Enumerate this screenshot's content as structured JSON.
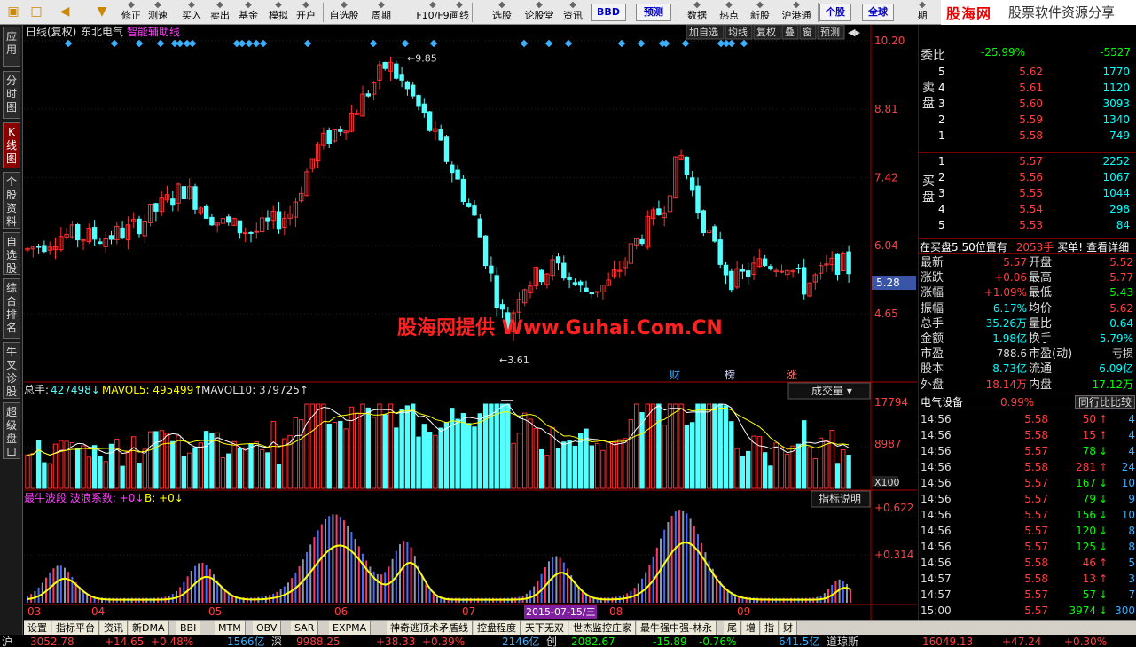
{
  "toolbar": {
    "items": [
      {
        "label": "修正"
      },
      {
        "label": "测速"
      },
      {
        "label": "买入"
      },
      {
        "label": "卖出"
      },
      {
        "label": "基金"
      },
      {
        "label": "模拟"
      },
      {
        "label": "开户"
      },
      {
        "label": "自选股"
      },
      {
        "label": "周期"
      },
      {
        "label": "F10/F9"
      },
      {
        "label": "画线"
      },
      {
        "label": "选股"
      },
      {
        "label": "论股堂"
      },
      {
        "label": "资讯"
      },
      {
        "label": "BBD"
      },
      {
        "label": "预测"
      },
      {
        "label": "数据"
      },
      {
        "label": "热点"
      },
      {
        "label": "新股"
      },
      {
        "label": "沪港通"
      },
      {
        "label": "个股"
      },
      {
        "label": "全球"
      },
      {
        "label": "期"
      }
    ],
    "brand_name": "股海网",
    "brand_sub": "股票软件资源分享",
    "brand_url": "www.Guhai.com.cn"
  },
  "left_tabs": [
    {
      "label": "应用"
    },
    {
      "label": "分时图"
    },
    {
      "label": "K线图"
    },
    {
      "label": "个股资料"
    },
    {
      "label": "自选股"
    },
    {
      "label": "综合排名"
    },
    {
      "label": "牛叉诊股"
    },
    {
      "label": "超级盘口"
    }
  ],
  "chart_header": {
    "period": "日线(复权)",
    "stock_name": "东北电气",
    "indicator": "智能辅助线",
    "buttons": [
      "加自选",
      "均线",
      "复权",
      "叠",
      "窗",
      "预测"
    ]
  },
  "price_axis": [
    "10.20",
    "8.81",
    "7.42",
    "6.04",
    "4.65"
  ],
  "current_price_marker": "5.28",
  "annotations": {
    "high": "9.85",
    "low": "3.61",
    "flags": [
      "财",
      "榜",
      "涨"
    ]
  },
  "volume_panel": {
    "total_label": "总手:",
    "total": "427498",
    "mavol5_label": "MAVOL5:",
    "mavol5": "495499",
    "mavol10_label": "MAVOL10:",
    "mavol10": "379725",
    "selector": "成交量",
    "axis": [
      "17794",
      "8987"
    ],
    "unit": "X100"
  },
  "indicator_panel": {
    "title": "最牛波段",
    "coef_label": "波浪系数:",
    "coef": "+0",
    "b_label": "B:",
    "b": "+0",
    "help": "指标说明",
    "axis": [
      "+0.622",
      "+0.314"
    ]
  },
  "date_axis": [
    "03",
    "04",
    "05",
    "06",
    "07",
    "08",
    "09"
  ],
  "date_cursor": "2015-07-15/三",
  "watermark": "股海网提供 Www.Guhai.Com.CN",
  "order_book": {
    "top_label": "委比",
    "top_value": "-25.99%",
    "top_diff": "-5527",
    "sell_label": "卖盘",
    "buy_label": "买盘",
    "sell": [
      {
        "level": "5",
        "price": "5.62",
        "vol": "1770"
      },
      {
        "level": "4",
        "price": "5.61",
        "vol": "1120"
      },
      {
        "level": "3",
        "price": "5.60",
        "vol": "3093"
      },
      {
        "level": "2",
        "price": "5.59",
        "vol": "1340"
      },
      {
        "level": "1",
        "price": "5.58",
        "vol": "749"
      }
    ],
    "buy": [
      {
        "level": "1",
        "price": "5.57",
        "vol": "2252"
      },
      {
        "level": "2",
        "price": "5.56",
        "vol": "1067"
      },
      {
        "level": "3",
        "price": "5.55",
        "vol": "1044"
      },
      {
        "level": "4",
        "price": "5.54",
        "vol": "298"
      },
      {
        "level": "5",
        "price": "5.53",
        "vol": "84"
      }
    ],
    "notice": "在买盘5.50位置有",
    "notice_vol": "2053手",
    "notice_action": "买单!",
    "notice_link": "查看详细"
  },
  "quote_stats": [
    {
      "l1": "最新",
      "v1": "5.57",
      "c1": "#ff4040",
      "l2": "开盘",
      "v2": "5.52",
      "c2": "#ff4040"
    },
    {
      "l1": "涨跌",
      "v1": "+0.06",
      "c1": "#ff4040",
      "l2": "最高",
      "v2": "5.77",
      "c2": "#ff4040"
    },
    {
      "l1": "涨幅",
      "v1": "+1.09%",
      "c1": "#ff4040",
      "l2": "最低",
      "v2": "5.43",
      "c2": "#00ff00"
    },
    {
      "l1": "振幅",
      "v1": "6.17%",
      "c1": "#00ffff",
      "l2": "均价",
      "v2": "5.62",
      "c2": "#ff4040"
    },
    {
      "l1": "总手",
      "v1": "35.26万",
      "c1": "#00ffff",
      "l2": "量比",
      "v2": "0.64",
      "c2": "#00ffff"
    },
    {
      "l1": "金额",
      "v1": "1.98亿",
      "c1": "#00ffff",
      "l2": "换手",
      "v2": "5.79%",
      "c2": "#00ffff"
    },
    {
      "l1": "市盈",
      "v1": "788.6",
      "c1": "#dddddd",
      "l2": "市盈(动)",
      "v2": "亏损",
      "c2": "#dddddd"
    },
    {
      "l1": "股本",
      "v1": "8.73亿",
      "c1": "#00ffff",
      "l2": "流通",
      "v2": "6.09亿",
      "c2": "#00ffff"
    },
    {
      "l1": "外盘",
      "v1": "18.14万",
      "c1": "#ff4040",
      "l2": "内盘",
      "v2": "17.12万",
      "c2": "#00ff00"
    }
  ],
  "sector": {
    "name": "电气设备",
    "change": "0.99%",
    "compare": "同行比比较"
  },
  "ticks": [
    {
      "time": "14:56",
      "price": "5.58",
      "vol": "50",
      "dir": "up",
      "num": "4"
    },
    {
      "time": "14:56",
      "price": "5.58",
      "vol": "15",
      "dir": "up",
      "num": "4"
    },
    {
      "time": "14:56",
      "price": "5.57",
      "vol": "78",
      "dir": "down",
      "num": "4"
    },
    {
      "time": "14:56",
      "price": "5.58",
      "vol": "281",
      "dir": "up",
      "num": "24"
    },
    {
      "time": "14:56",
      "price": "5.57",
      "vol": "167",
      "dir": "down",
      "num": "10"
    },
    {
      "time": "14:56",
      "price": "5.57",
      "vol": "79",
      "dir": "down",
      "num": "9"
    },
    {
      "time": "14:56",
      "price": "5.57",
      "vol": "156",
      "dir": "down",
      "num": "10"
    },
    {
      "time": "14:56",
      "price": "5.57",
      "vol": "120",
      "dir": "down",
      "num": "8"
    },
    {
      "time": "14:56",
      "price": "5.57",
      "vol": "125",
      "dir": "down",
      "num": "8"
    },
    {
      "time": "14:56",
      "price": "5.58",
      "vol": "46",
      "dir": "up",
      "num": "5"
    },
    {
      "time": "14:57",
      "price": "5.58",
      "vol": "13",
      "dir": "up",
      "num": "3"
    },
    {
      "time": "14:57",
      "price": "5.57",
      "vol": "57",
      "dir": "down",
      "num": "7"
    },
    {
      "time": "15:00",
      "price": "5.57",
      "vol": "3974",
      "dir": "down",
      "num": "300"
    }
  ],
  "bottom_tabs": [
    {
      "label": "设置"
    },
    {
      "label": "指标平台"
    },
    {
      "label": "资讯"
    },
    {
      "label": "新DMA"
    },
    {
      "label": "BBI"
    },
    {
      "label": "MTM"
    },
    {
      "label": "OBV"
    },
    {
      "label": "SAR"
    },
    {
      "label": "EXPMA"
    },
    {
      "label": "神奇逃顶术矛盾线"
    },
    {
      "label": "控盘程度"
    },
    {
      "label": "天下无双"
    },
    {
      "label": "世杰监控庄家"
    },
    {
      "label": "最牛强中强-林永"
    },
    {
      "label": "尾"
    },
    {
      "label": "增"
    },
    {
      "label": "指"
    },
    {
      "label": "财"
    }
  ],
  "status": {
    "sh": "沪",
    "sh_idx": "3052.78",
    "sh_chg": "+14.65",
    "sh_pct": "+0.48%",
    "sh_amt": "1566亿",
    "sz": "深",
    "sz_idx": "9988.25",
    "sz_chg": "+38.33",
    "sz_pct": "+0.39%",
    "sz_amt": "2146亿",
    "cy": "创",
    "cy_idx": "2082.67",
    "cy_chg": "-15.89",
    "cy_pct": "-0.76%",
    "cy_amt": "641.5亿",
    "dj": "道琼斯",
    "dj_idx": "16049.13",
    "dj_chg": "+47.24",
    "dj_pct": "+0.30%"
  },
  "colors": {
    "up": "#ff3030",
    "down": "#54ffff",
    "ma": "#ffff00",
    "grid": "#7a0000"
  }
}
